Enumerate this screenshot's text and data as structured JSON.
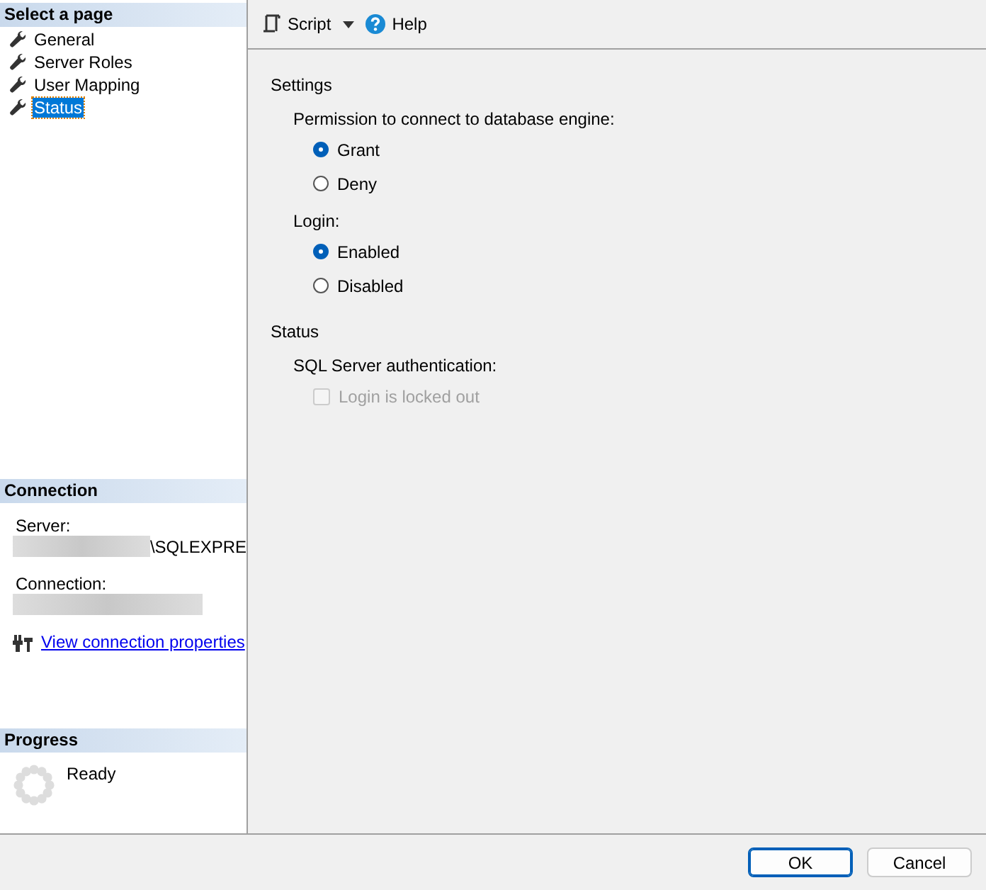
{
  "sidebar": {
    "title": "Select a page",
    "items": [
      {
        "label": "General",
        "selected": false
      },
      {
        "label": "Server Roles",
        "selected": false
      },
      {
        "label": "User Mapping",
        "selected": false
      },
      {
        "label": "Status",
        "selected": true
      }
    ]
  },
  "connection": {
    "title": "Connection",
    "server_label": "Server:",
    "server_value": "\\SQLEXPRE",
    "connection_label": "Connection:",
    "link": "View connection properties"
  },
  "progress": {
    "title": "Progress",
    "status": "Ready"
  },
  "toolbar": {
    "script": "Script",
    "help": "Help"
  },
  "settings": {
    "title": "Settings",
    "groups": [
      {
        "label": "Permission to connect to database engine:",
        "options": [
          {
            "label": "Grant",
            "selected": true
          },
          {
            "label": "Deny",
            "selected": false
          }
        ]
      },
      {
        "label": "Login:",
        "options": [
          {
            "label": "Enabled",
            "selected": true
          },
          {
            "label": "Disabled",
            "selected": false
          }
        ]
      }
    ]
  },
  "status": {
    "title": "Status",
    "auth_label": "SQL Server authentication:",
    "locked_out": {
      "label": "Login is locked out",
      "checked": false,
      "disabled": true
    }
  },
  "buttons": [
    {
      "label": "OK",
      "kind": "default"
    },
    {
      "label": "Cancel",
      "kind": "normal"
    }
  ]
}
